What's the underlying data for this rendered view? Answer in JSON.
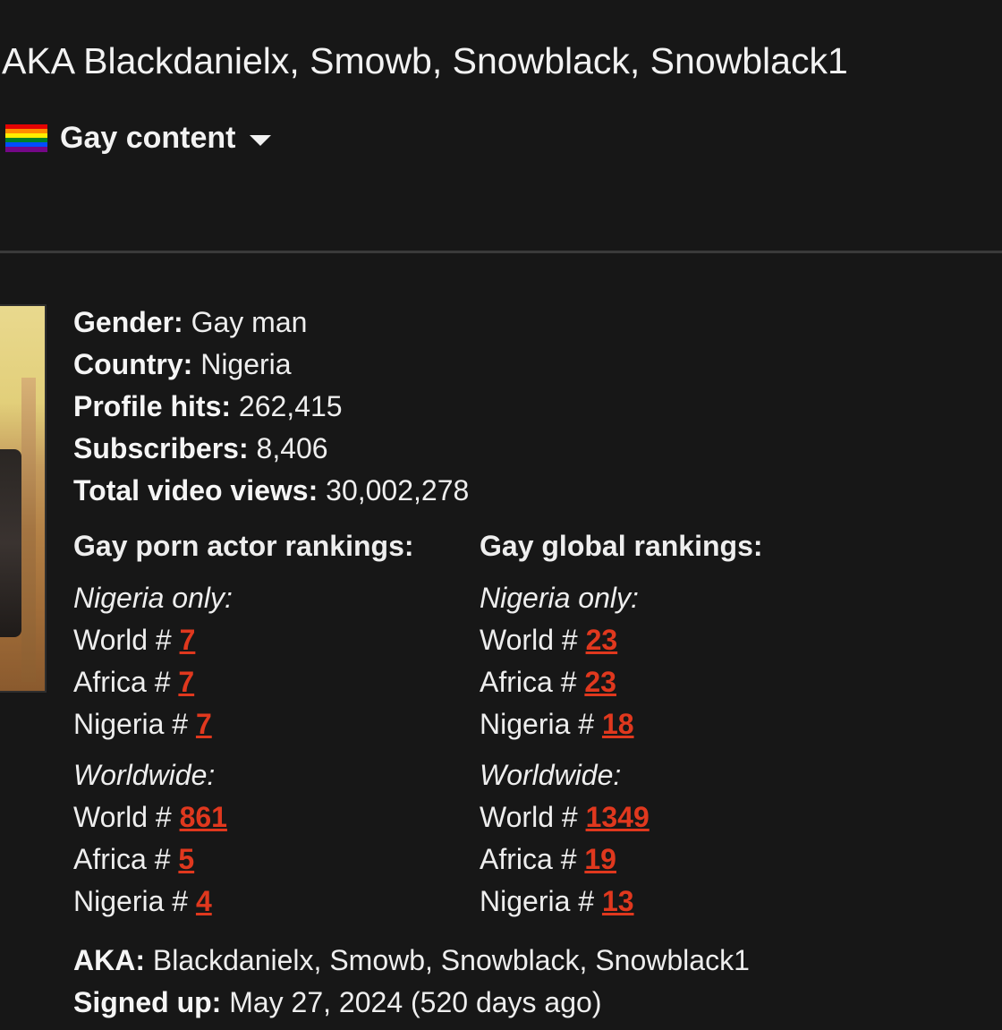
{
  "header": {
    "aka_heading": "AKA Blackdanielx, Smowb, Snowblack, Snowblack1",
    "content_filter": {
      "label": "Gay content",
      "flag_colors": [
        "#e40303",
        "#ff8c00",
        "#ffed00",
        "#008026",
        "#004dff",
        "#750787"
      ]
    }
  },
  "profile": {
    "gender_label": "Gender:",
    "gender_value": "Gay man",
    "country_label": "Country:",
    "country_value": "Nigeria",
    "hits_label": "Profile hits:",
    "hits_value": "262,415",
    "subscribers_label": "Subscribers:",
    "subscribers_value": "8,406",
    "views_label": "Total video views:",
    "views_value": "30,002,278"
  },
  "rankings": {
    "actor": {
      "title": "Gay porn actor rankings:",
      "local": {
        "heading": "Nigeria only:",
        "rows": [
          {
            "label": "World #",
            "value": "7"
          },
          {
            "label": "Africa #",
            "value": "7"
          },
          {
            "label": "Nigeria #",
            "value": "7"
          }
        ]
      },
      "worldwide": {
        "heading": "Worldwide:",
        "rows": [
          {
            "label": "World #",
            "value": "861"
          },
          {
            "label": "Africa #",
            "value": "5"
          },
          {
            "label": "Nigeria #",
            "value": "4"
          }
        ]
      }
    },
    "global": {
      "title": "Gay global rankings:",
      "local": {
        "heading": "Nigeria only:",
        "rows": [
          {
            "label": "World #",
            "value": "23"
          },
          {
            "label": "Africa #",
            "value": "23"
          },
          {
            "label": "Nigeria #",
            "value": "18"
          }
        ]
      },
      "worldwide": {
        "heading": "Worldwide:",
        "rows": [
          {
            "label": "World #",
            "value": "1349"
          },
          {
            "label": "Africa #",
            "value": "19"
          },
          {
            "label": "Nigeria #",
            "value": "13"
          }
        ]
      }
    }
  },
  "footer": {
    "aka_label": "AKA:",
    "aka_value": "Blackdanielx, Smowb, Snowblack, Snowblack1",
    "signed_up_label": "Signed up:",
    "signed_up_value": "May 27, 2024 (520 days ago)"
  }
}
